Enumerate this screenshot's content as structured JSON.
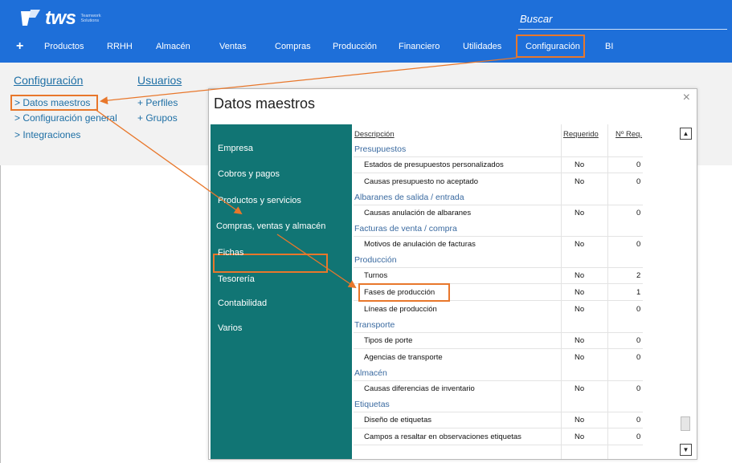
{
  "header": {
    "logo_text": "tws",
    "logo_sub": "Teamwork Solutions",
    "search_placeholder": "Buscar",
    "nav": [
      "+",
      "Productos",
      "RRHH",
      "Almacén",
      "Ventas",
      "Compras",
      "Producción",
      "Financiero",
      "Utilidades",
      "Configuración",
      "BI"
    ]
  },
  "page": {
    "col1_title": "Configuración",
    "col1_links": [
      "> Datos maestros",
      "> Configuración general",
      "> Integraciones"
    ],
    "col2_title": "Usuarios",
    "col2_links": [
      "+ Perfiles",
      "+ Grupos"
    ]
  },
  "dialog": {
    "title": "Datos maestros",
    "close": "×",
    "menu": [
      "Empresa",
      "Cobros y pagos",
      "Productos y servicios",
      "Compras, ventas y almacén",
      "Fichas",
      "Tesorería",
      "Contabilidad",
      "Varios"
    ],
    "columns": {
      "desc": "Descripción",
      "req": "Requerido",
      "num": "Nº Req."
    },
    "groups": [
      {
        "name": "Presupuestos",
        "rows": [
          {
            "name": "Estados de presupuestos personalizados",
            "req": "No",
            "num": "0"
          },
          {
            "name": "Causas presupuesto no aceptado",
            "req": "No",
            "num": "0"
          }
        ]
      },
      {
        "name": "Albaranes de salida / entrada",
        "rows": [
          {
            "name": "Causas anulación de albaranes",
            "req": "No",
            "num": "0"
          }
        ]
      },
      {
        "name": "Facturas de venta / compra",
        "rows": [
          {
            "name": "Motivos de anulación de facturas",
            "req": "No",
            "num": "0"
          }
        ]
      },
      {
        "name": "Producción",
        "rows": [
          {
            "name": "Turnos",
            "req": "No",
            "num": "2"
          },
          {
            "name": "Fases de producción",
            "req": "No",
            "num": "1"
          },
          {
            "name": "Líneas de producción",
            "req": "No",
            "num": "0"
          }
        ]
      },
      {
        "name": "Transporte",
        "rows": [
          {
            "name": "Tipos de porte",
            "req": "No",
            "num": "0"
          },
          {
            "name": "Agencias de transporte",
            "req": "No",
            "num": "0"
          }
        ]
      },
      {
        "name": "Almacén",
        "rows": [
          {
            "name": "Causas diferencias de inventario",
            "req": "No",
            "num": "0"
          }
        ]
      },
      {
        "name": "Etiquetas",
        "rows": [
          {
            "name": "Diseño de etiquetas",
            "req": "No",
            "num": "0"
          },
          {
            "name": "Campos a resaltar en observaciones etiquetas",
            "req": "No",
            "num": "0"
          }
        ]
      }
    ]
  },
  "colors": {
    "header_blue": "#1e6fd9",
    "teal": "#117574",
    "highlight": "#e8772b",
    "link": "#1e6fa5"
  }
}
